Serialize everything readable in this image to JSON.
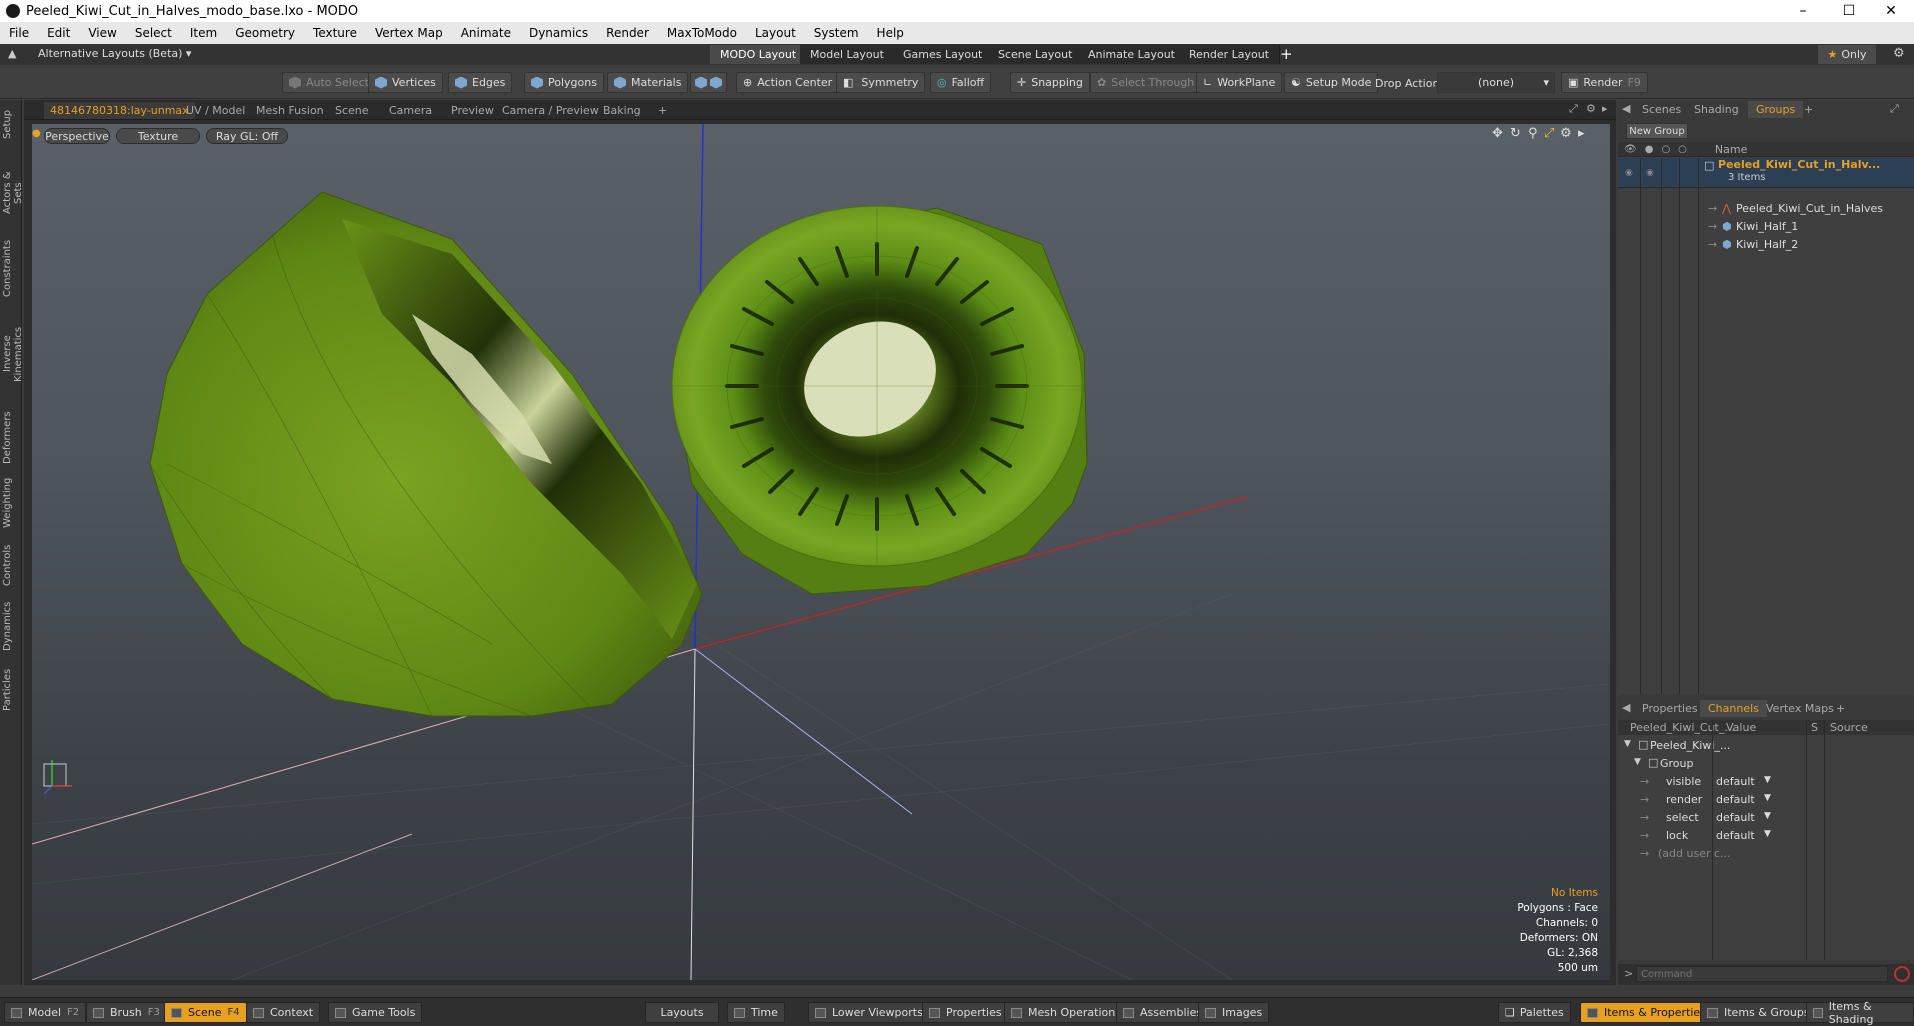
{
  "window": {
    "title": "Peeled_Kiwi_Cut_in_Halves_modo_base.lxo - MODO"
  },
  "menu": [
    "File",
    "Edit",
    "View",
    "Select",
    "Item",
    "Geometry",
    "Texture",
    "Vertex Map",
    "Animate",
    "Dynamics",
    "Render",
    "MaxToModo",
    "Layout",
    "System",
    "Help"
  ],
  "layoutbar": {
    "alt_layouts": "Alternative Layouts (Beta)",
    "tabs": [
      "MODO Layout",
      "Model Layout",
      "Games Layout",
      "Scene Layout",
      "Animate Layout",
      "Render Layout"
    ],
    "active_tab": "MODO Layout",
    "only_label": "Only"
  },
  "toolbar": {
    "auto_select": "Auto Select",
    "vertices": "Vertices",
    "edges": "Edges",
    "polygons": "Polygons",
    "materials": "Materials",
    "action_center": "Action Center",
    "symmetry": "Symmetry",
    "falloff": "Falloff",
    "snapping": "Snapping",
    "select_through": "Select Through",
    "workplane": "WorkPlane",
    "setup_mode": "Setup Mode",
    "drop_action": "Drop Action",
    "drop_value": "(none)",
    "render": "Render",
    "render_key": "F9"
  },
  "left_tabs": [
    "Setup",
    "Actors & Sets",
    "Constraints",
    "Inverse Kinematics",
    "Deformers",
    "Weighting",
    "Controls",
    "Dynamics",
    "Particles"
  ],
  "viewport_tabs": [
    "48146780318:lay-unmax",
    "UV / Model",
    "Mesh Fusion",
    "Scene",
    "Camera",
    "Preview",
    "Camera / Preview",
    "Baking",
    "+"
  ],
  "viewport": {
    "perspective": "Perspective",
    "texture": "Texture",
    "raygl": "Ray GL: Off",
    "info": {
      "items": "No Items",
      "polygons": "Polygons : Face",
      "channels": "Channels: 0",
      "deformers": "Deformers: ON",
      "gl": "GL: 2,368",
      "scale": "500 um"
    },
    "colors": {
      "x_axis": "#d02020",
      "y_axis": "#2030d0",
      "kiwi_green": "#6f9a1a",
      "kiwi_core": "#d8dfb0"
    }
  },
  "right_panel": {
    "top_tabs": [
      "Scenes",
      "Shading",
      "Groups",
      "+"
    ],
    "active_top": "Groups",
    "new_group": "New Group",
    "name_header": "Name",
    "group_root": "Peeled_Kiwi_Cut_in_Halv...",
    "group_count": "3 Items",
    "children": [
      "Peeled_Kiwi_Cut_in_Halves",
      "Kiwi_Half_1",
      "Kiwi_Half_2"
    ],
    "bottom_tabs": [
      "Properties",
      "Channels",
      "Vertex Maps",
      "+"
    ],
    "active_bottom": "Channels",
    "channel_headers": {
      "name": "Peeled_Kiwi_Cut_...",
      "value": "Value",
      "s": "S",
      "source": "Source"
    },
    "channel_root": "Peeled_Kiwi_...",
    "channel_group": "Group",
    "channels": [
      {
        "name": "visible",
        "value": "default"
      },
      {
        "name": "render",
        "value": "default"
      },
      {
        "name": "select",
        "value": "default"
      },
      {
        "name": "lock",
        "value": "default"
      }
    ],
    "add_user": "(add user c...",
    "command_placeholder": "Command"
  },
  "statusbar": {
    "left": [
      {
        "label": "Model",
        "key": "F2"
      },
      {
        "label": "Brush",
        "key": "F3"
      },
      {
        "label": "Scene",
        "key": "F4"
      },
      {
        "label": "Context",
        "key": ""
      },
      {
        "label": "Game Tools",
        "key": ""
      }
    ],
    "middle": [
      "Layouts",
      "Time",
      "Lower Viewports",
      "Properties",
      "Mesh Operations",
      "Assemblies",
      "Images"
    ],
    "right": [
      "Palettes",
      "Items & Properties",
      "Items & Groups",
      "Items & Shading"
    ]
  }
}
